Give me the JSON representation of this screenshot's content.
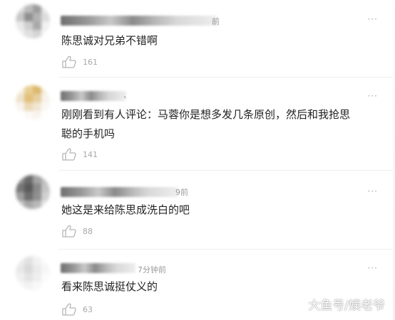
{
  "comments": [
    {
      "time": "前",
      "text": "陈思诚对兄弟不错啊",
      "likes": "161",
      "avatar_colors": [
        "#d9d9d9",
        "#bdbdbd",
        "#9c9c9c",
        "#e6e6e6",
        "#c7c7c7",
        "#8f8f8f",
        "#b3b3b3",
        "#dcdcdc",
        "#eaeaea",
        "#cfcfcf",
        "#a9a9a9",
        "#f0f0f0",
        "#efefef",
        "#e0e0e0",
        "#d5d5d5",
        "#f5f5f5"
      ]
    },
    {
      "time": "、",
      "text": "刚刚看到有人评论：马蓉你是想多发几条原创，然后和我抢思聪的手机吗",
      "likes": "141",
      "avatar_colors": [
        "#f7efe2",
        "#e9cf94",
        "#dcb96d",
        "#f3eadb",
        "#eee3cc",
        "#e2c07a",
        "#e7cfa1",
        "#f7f2ea",
        "#f8f4ef",
        "#ecdab7",
        "#f1e6d2",
        "#faf8f4",
        "#ffffff",
        "#fbf9f6",
        "#f8f4ee",
        "#ffffff"
      ]
    },
    {
      "time": "9前",
      "text": "她这是来给陈思成洗白的吧",
      "likes": "88",
      "avatar_colors": [
        "#8d8d8d",
        "#6b6b6b",
        "#a3a3a3",
        "#bdbdbd",
        "#777777",
        "#5a5a5a",
        "#8a8a8a",
        "#c4c4c4",
        "#9e9e9e",
        "#6e6e6e",
        "#8f8f8f",
        "#d0d0d0",
        "#c2c2c2",
        "#a8a8a8",
        "#b9b9b9",
        "#e4e4e4"
      ]
    },
    {
      "time": "7分钟前",
      "text": "看来陈思诚挺仗义的",
      "likes": "63",
      "avatar_colors": [
        "#eeeeee",
        "#e2e2e2",
        "#f2f2f2",
        "#fafafa",
        "#e8e8e8",
        "#d9d9d9",
        "#ebebeb",
        "#f6f6f6",
        "#f0f0f0",
        "#e4e4e4",
        "#eeeeee",
        "#fbfbfb",
        "#f7f7f7",
        "#f3f3f3",
        "#f8f8f8",
        "#ffffff"
      ]
    }
  ],
  "more_icon": "···",
  "watermark": "大鱼号/娱老爷",
  "icons": {
    "like": "thumbs-up-icon",
    "more": "more-dots-icon"
  }
}
